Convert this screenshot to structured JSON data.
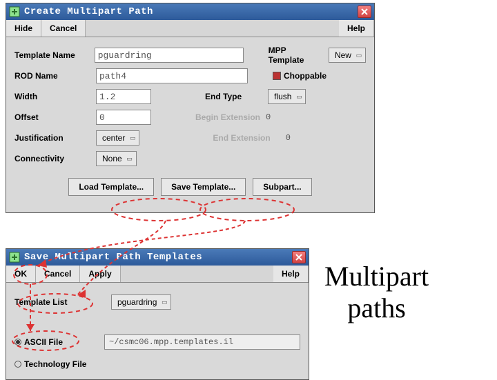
{
  "win1": {
    "title": "Create Multipart Path",
    "bar": {
      "hide": "Hide",
      "cancel": "Cancel",
      "help": "Help"
    },
    "fields": {
      "templateName_lbl": "Template Name",
      "templateName_val": "pguardring",
      "mppTemplate_lbl": "MPP Template",
      "new_btn": "New",
      "rodName_lbl": "ROD Name",
      "rodName_val": "path4",
      "choppable_lbl": "Choppable",
      "width_lbl": "Width",
      "width_val": "1.2",
      "endType_lbl": "End Type",
      "endType_val": "flush",
      "offset_lbl": "Offset",
      "offset_val": "0",
      "beginExt_lbl": "Begin Extension",
      "beginExt_val": "0",
      "justification_lbl": "Justification",
      "justification_val": "center",
      "endExt_lbl": "End Extension",
      "endExt_val": "0",
      "connectivity_lbl": "Connectivity",
      "connectivity_val": "None"
    },
    "actions": {
      "load": "Load Template...",
      "save": "Save Template...",
      "subpart": "Subpart..."
    }
  },
  "win2": {
    "title": "Save Multipart Path Templates",
    "bar": {
      "ok": "OK",
      "cancel": "Cancel",
      "apply": "Apply",
      "help": "Help"
    },
    "templateList_lbl": "Template List",
    "templateList_val": "pguardring",
    "asciiFile_lbl": "ASCII File",
    "asciiFile_val": "~/csmc06.mpp.templates.il",
    "techFile_lbl": "Technology File"
  },
  "caption_line1": "Multipart",
  "caption_line2": "paths"
}
